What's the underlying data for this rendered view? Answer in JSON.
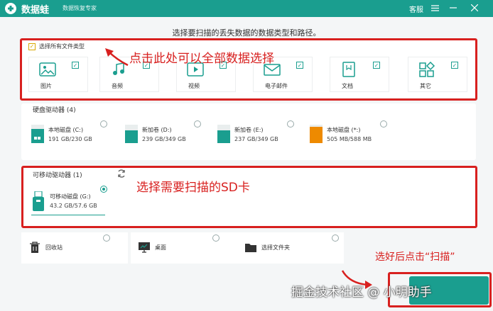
{
  "titlebar": {
    "app_name": "数据蛙",
    "subtitle": "数据恢复专家",
    "service": "客服",
    "menu_icon": "hamburger-icon",
    "min_icon": "minimize-icon",
    "close_icon": "close-icon"
  },
  "instruction": "选择要扫描的丢失数据的数据类型和路径。",
  "file_types": {
    "select_all": "选择所有文件类型",
    "items": [
      {
        "label": "图片",
        "icon": "image-icon"
      },
      {
        "label": "音频",
        "icon": "audio-icon"
      },
      {
        "label": "视频",
        "icon": "video-icon"
      },
      {
        "label": "电子邮件",
        "icon": "email-icon"
      },
      {
        "label": "文档",
        "icon": "document-icon"
      },
      {
        "label": "其它",
        "icon": "others-icon"
      }
    ]
  },
  "annotations": {
    "select_all_hint": "点击此处可以全部数据选择",
    "sd_hint": "选择需要扫描的SD卡",
    "scan_hint": "选好后点击“扫描”"
  },
  "hard_drives": {
    "title": "硬盘驱动器 (4)",
    "items": [
      {
        "name": "本地磁盘 (C:)",
        "size": "191 GB/230 GB",
        "color": "#1a9e8f"
      },
      {
        "name": "新加卷 (D:)",
        "size": "239 GB/349 GB",
        "color": "#1a9e8f"
      },
      {
        "name": "新加卷 (E:)",
        "size": "237 GB/349 GB",
        "color": "#1a9e8f"
      },
      {
        "name": "本地磁盘 (*:)",
        "size": "505 MB/588 MB",
        "color": "#ee8a00"
      }
    ]
  },
  "removable": {
    "title": "可移动驱动器 (1)",
    "items": [
      {
        "name": "可移动磁盘 (G:)",
        "size": "43.2 GB/57.6 GB",
        "selected": true
      }
    ]
  },
  "locations": [
    {
      "label": "回收站",
      "icon": "trash-icon"
    },
    {
      "label": "桌面",
      "icon": "desktop-icon"
    },
    {
      "label": "选择文件夹",
      "icon": "folder-icon"
    }
  ],
  "watermark": "掘金技术社区 @ 小明助手",
  "colors": {
    "brand": "#1a9e8f",
    "annotation": "#d8201f",
    "warning": "#ee8a00"
  }
}
